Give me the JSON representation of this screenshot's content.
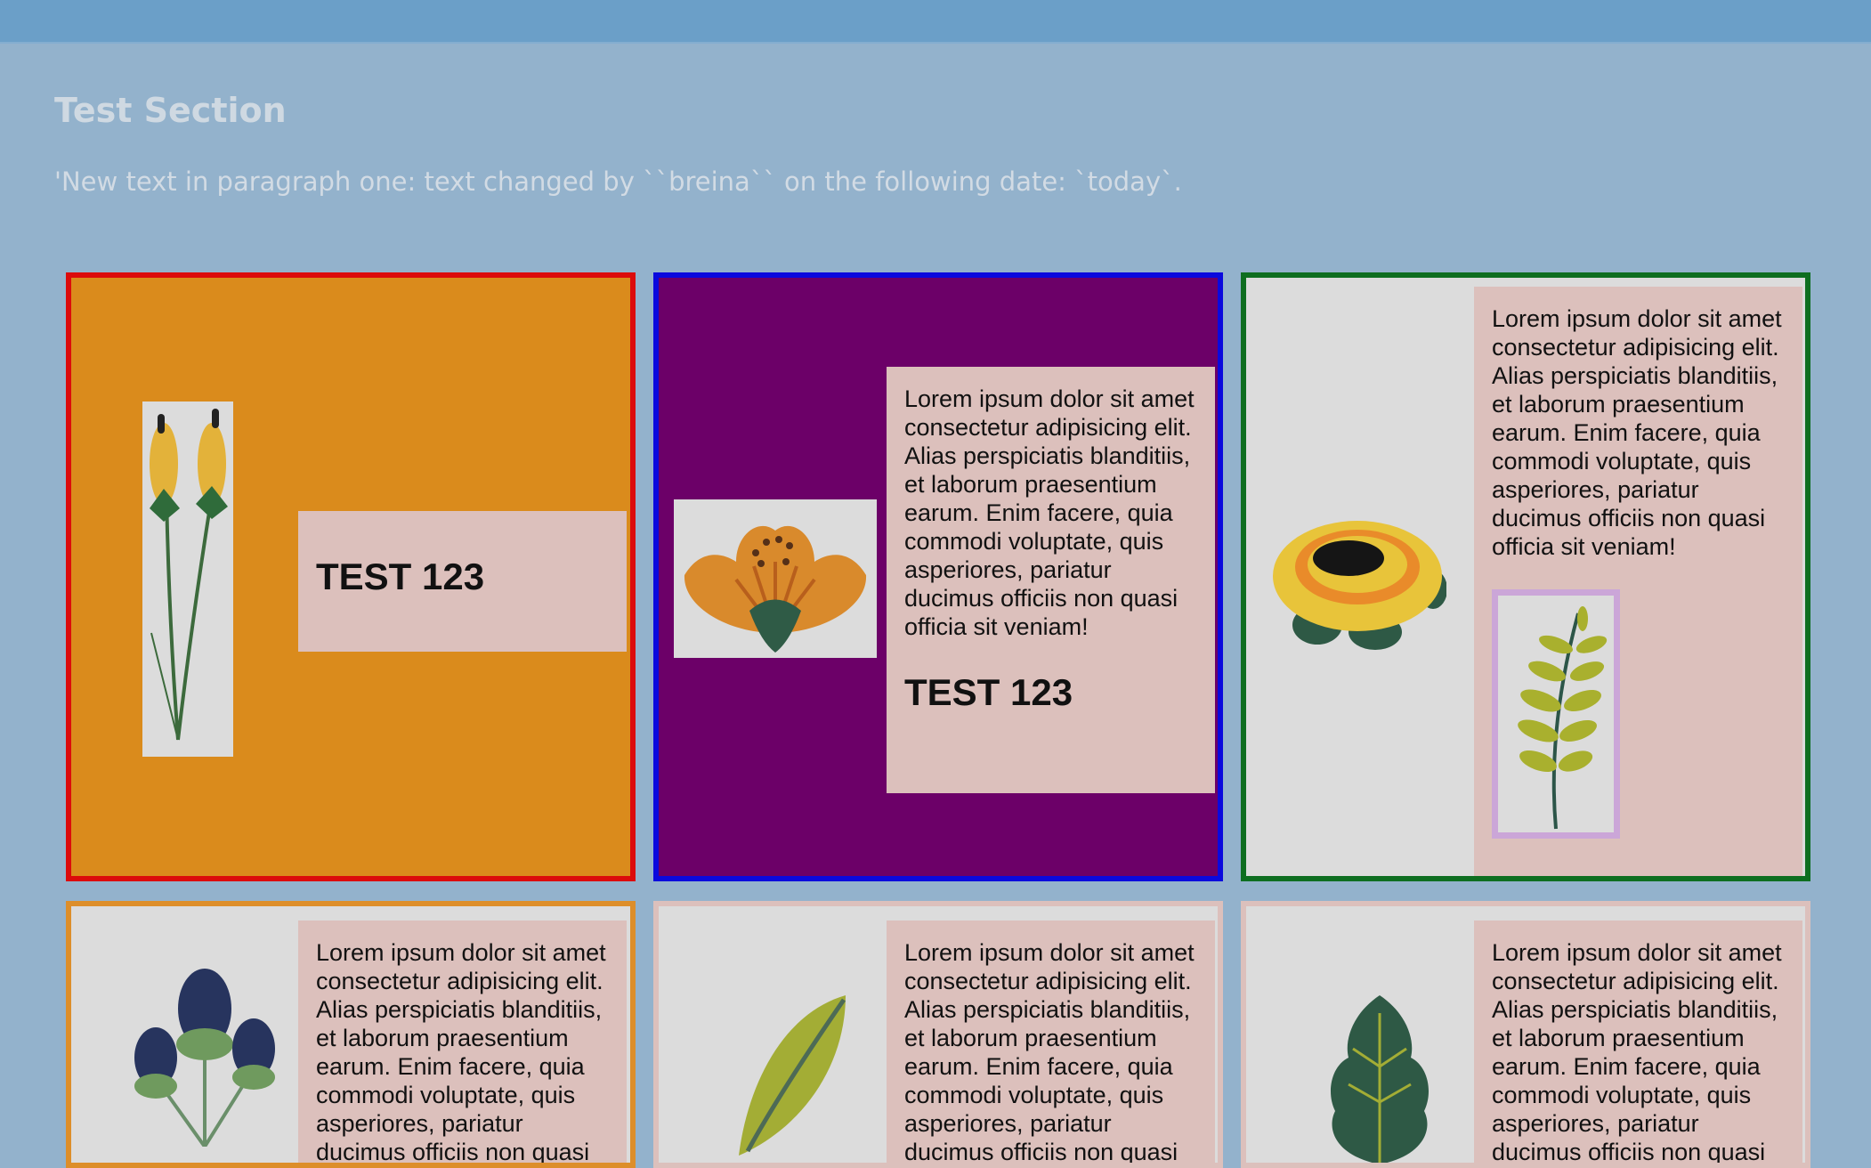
{
  "section": {
    "title": "Test Section",
    "paragraph": "'New text in paragraph one: text changed by ``breina`` on the following date: `today`."
  },
  "lorem": "Lorem ipsum dolor sit amet consectetur adipisicing elit. Alias perspiciatis blanditiis, et laborum praesentium earum. Enim facere, quia commodi voluptate, quis asperiores, pariatur ducimus officiis non quasi officia sit veniam!",
  "cards": [
    {
      "id": 1,
      "heading": "TEST 123",
      "image": "wildflower-buds-illustration",
      "background": "#da8b1c",
      "border": "#dc0b0b"
    },
    {
      "id": 2,
      "heading": "TEST 123",
      "image": "orange-lily-illustration",
      "background": "#6c0068",
      "border": "#0a09dd"
    },
    {
      "id": 3,
      "images": [
        "yellow-rose-illustration",
        "fern-sprig-illustration"
      ],
      "background": "#dcdcdc",
      "border": "#0e6e20",
      "inner_border": "#cba6d8"
    },
    {
      "id": 4,
      "image": "blue-thistle-illustration",
      "border": "#dd8e2a"
    },
    {
      "id": 5,
      "image": "green-leaf-illustration",
      "border": "#dcc0bc"
    },
    {
      "id": 6,
      "image": "dark-leaf-illustration",
      "border": "#dcc0bc"
    }
  ]
}
